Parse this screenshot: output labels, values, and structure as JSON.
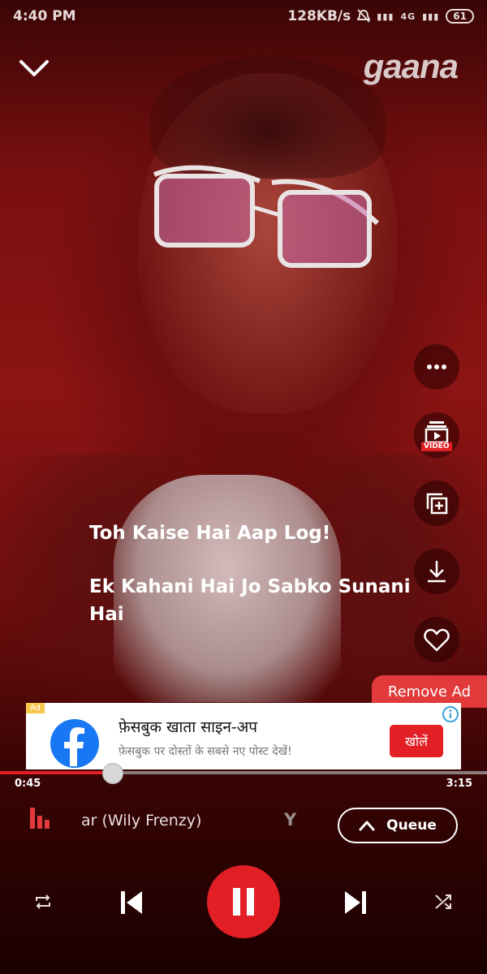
{
  "status_bar": {
    "time": "4:40 PM",
    "speed": "128KB/s",
    "net_1": "4G",
    "battery": "61"
  },
  "header": {
    "collapse_icon": "chevron-down-icon",
    "logo": "gaana"
  },
  "side_actions": [
    {
      "name": "more-icon"
    },
    {
      "name": "video-icon",
      "badge": "VIDEO"
    },
    {
      "name": "add-to-playlist-icon"
    },
    {
      "name": "download-icon"
    },
    {
      "name": "heart-icon"
    }
  ],
  "lyrics": {
    "line1": "Toh Kaise Hai Aap Log!",
    "line2a": "Ek Kahani Hai Jo Sabko Sunani",
    "line2b": "Hai"
  },
  "ad": {
    "remove_label": "Remove Ad",
    "tag": "Ad",
    "title": "फ़ेसबुक खाता साइन-अप",
    "subtitle": "फ़ेसबुक पर दोस्तों के सबसे नए पोस्ट देखें!",
    "cta": "खोलें"
  },
  "player": {
    "current_time": "0:45",
    "total_time": "3:15",
    "progress": 0.2308,
    "track_text": "ar (Wily Frenzy)",
    "next_text": "Y",
    "queue_label": "Queue"
  },
  "colors": {
    "accent": "#e21f24",
    "facebook": "#1877f2"
  }
}
